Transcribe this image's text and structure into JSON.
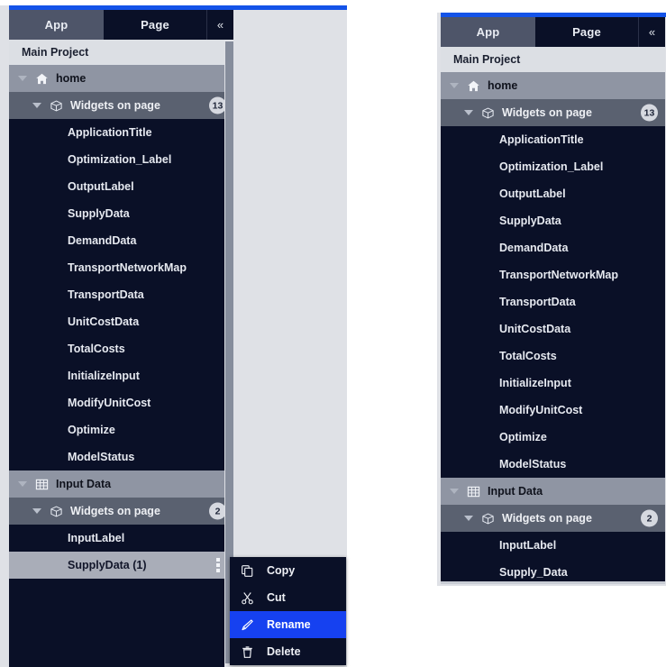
{
  "window": {
    "accent_color": "#1453e8",
    "panel_bg": "#0a1027",
    "selection_bg": "#a9adb8",
    "highlight_color": "#1641f0"
  },
  "tabs": {
    "app_label": "App",
    "page_label": "Page",
    "collapse_label": "«",
    "active": "App"
  },
  "tree": {
    "project": {
      "label": "Main Project"
    },
    "pages": [
      {
        "label": "home",
        "icon": "home-icon",
        "group": {
          "label": "Widgets on page",
          "icon": "widgets-icon",
          "count": "13"
        },
        "widgets": [
          {
            "label": "ApplicationTitle"
          },
          {
            "label": "Optimization_Label"
          },
          {
            "label": "OutputLabel"
          },
          {
            "label": "SupplyData"
          },
          {
            "label": "DemandData"
          },
          {
            "label": "TransportNetworkMap"
          },
          {
            "label": "TransportData"
          },
          {
            "label": "UnitCostData"
          },
          {
            "label": "TotalCosts"
          },
          {
            "label": "InitializeInput"
          },
          {
            "label": "ModifyUnitCost"
          },
          {
            "label": "Optimize"
          },
          {
            "label": "ModelStatus"
          }
        ]
      },
      {
        "label": "Input Data",
        "icon": "table-icon",
        "group": {
          "label": "Widgets on page",
          "icon": "widgets-icon",
          "count": "2"
        },
        "widgets": [
          {
            "label": "InputLabel"
          },
          {
            "label": "SupplyData (1)",
            "selected": true,
            "kebab": true
          }
        ]
      }
    ]
  },
  "tree_after": {
    "project": {
      "label": "Main Project"
    },
    "pages": [
      {
        "label": "home",
        "icon": "home-icon",
        "group": {
          "label": "Widgets on page",
          "icon": "widgets-icon",
          "count": "13"
        },
        "widgets": [
          {
            "label": "ApplicationTitle"
          },
          {
            "label": "Optimization_Label"
          },
          {
            "label": "OutputLabel"
          },
          {
            "label": "SupplyData"
          },
          {
            "label": "DemandData"
          },
          {
            "label": "TransportNetworkMap"
          },
          {
            "label": "TransportData"
          },
          {
            "label": "UnitCostData"
          },
          {
            "label": "TotalCosts"
          },
          {
            "label": "InitializeInput"
          },
          {
            "label": "ModifyUnitCost"
          },
          {
            "label": "Optimize"
          },
          {
            "label": "ModelStatus"
          }
        ]
      },
      {
        "label": "Input Data",
        "icon": "table-icon",
        "group": {
          "label": "Widgets on page",
          "icon": "widgets-icon",
          "count": "2"
        },
        "widgets": [
          {
            "label": "InputLabel"
          },
          {
            "label": "Supply_Data"
          }
        ]
      }
    ]
  },
  "context_menu": {
    "items": [
      {
        "label": "Copy",
        "icon": "copy-icon",
        "highlighted": false
      },
      {
        "label": "Cut",
        "icon": "cut-icon",
        "highlighted": false
      },
      {
        "label": "Rename",
        "icon": "pencil-icon",
        "highlighted": true
      },
      {
        "label": "Delete",
        "icon": "trash-icon",
        "highlighted": false
      }
    ]
  }
}
